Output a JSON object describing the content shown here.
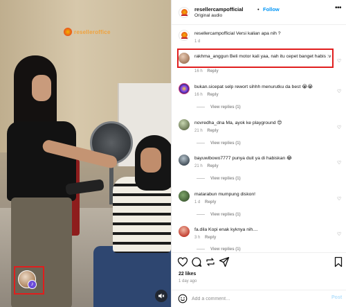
{
  "media": {
    "watermark_text": "reselleroffice",
    "creator_avatar_icon": "profile-avatar",
    "badge_icon": "music-note-icon",
    "mute_icon": "speaker-muted-icon"
  },
  "header": {
    "username": "resellercampofficial",
    "separator": "•",
    "follow_label": "Follow",
    "audio_label": "Original audio",
    "more_label": "•••"
  },
  "comments": [
    {
      "username": "resellercampofficial",
      "text": "Versi kalian apa nih ?",
      "time": "1 d",
      "reply_label": ""
    },
    {
      "username": "rakhma_anggun",
      "text": "Beli motor kali yaa, nah itu cepet banget habis :v",
      "time": "16 h",
      "reply_label": "Reply"
    },
    {
      "username": "bukan.sicepat",
      "text": "selp rewort sihhh menurutku da best 😭😭",
      "time": "16 h",
      "reply_label": "Reply",
      "view_replies": "View replies (1)"
    },
    {
      "username": "novredha_dna",
      "text": "Ma, ayok ke playground 😍",
      "time": "21 h",
      "reply_label": "Reply",
      "view_replies": "View replies (1)"
    },
    {
      "username": "bayuwibowo7777",
      "text": "punya duit ya di habiskan 😂",
      "time": "21 h",
      "reply_label": "Reply",
      "view_replies": "View replies (1)"
    },
    {
      "username": "matarabun",
      "text": "mumpung diskon!",
      "time": "1 d",
      "reply_label": "Reply",
      "view_replies": "View replies (1)"
    },
    {
      "username": "fa.dila",
      "text": "Kopi enak kyknya nih....",
      "time": "3 h",
      "reply_label": "Reply",
      "view_replies": "View replies (1)"
    }
  ],
  "actions": {
    "likes": "22 likes",
    "date": "1 day ago"
  },
  "add_comment": {
    "placeholder": "Add a comment…",
    "post_label": "Post"
  },
  "colors": {
    "accent": "#0095f6",
    "highlight": "#e11d1d",
    "muted": "#8e8e8e"
  }
}
